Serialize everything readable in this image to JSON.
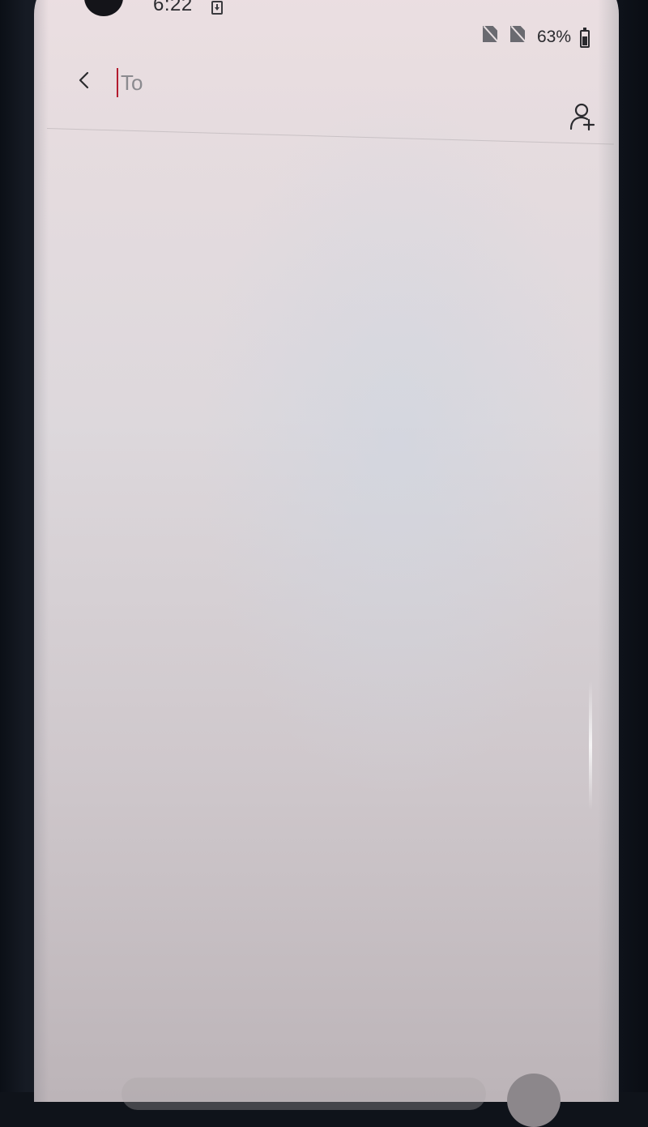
{
  "status_bar": {
    "time": "6:22",
    "battery_percent": "63%",
    "icons": [
      "camera-cutout",
      "download-icon",
      "no-sim-icon",
      "no-sim-icon",
      "battery-icon"
    ]
  },
  "compose": {
    "to_placeholder": "To",
    "to_value": "",
    "back_icon": "chevron-left-icon",
    "add_contact_icon": "add-contact-icon"
  },
  "colors": {
    "cursor": "#b31b2e",
    "screen_background": "#e6dcdf",
    "icon": "#2a2a2e"
  }
}
